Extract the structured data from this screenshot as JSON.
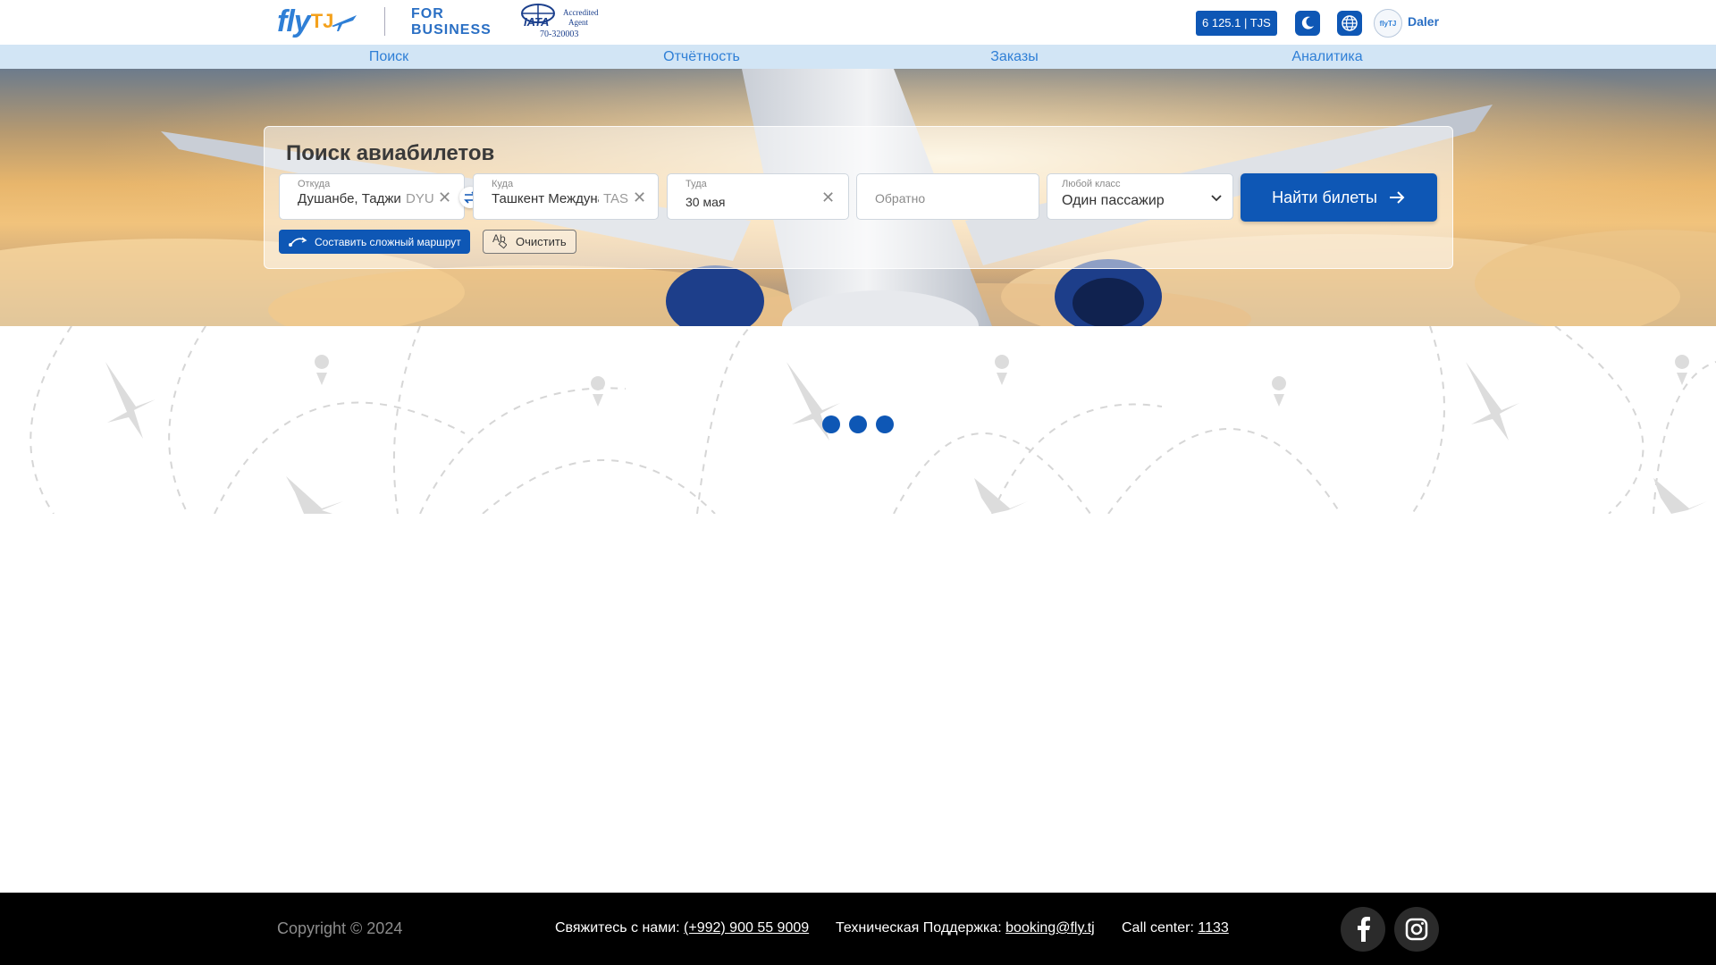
{
  "header": {
    "logo_text": "fly",
    "logo_tj": "TJ",
    "business_line1": "FOR",
    "business_line2": "BUSINESS",
    "iata_label": "IATA",
    "iata_accredited": "Accredited",
    "iata_agent": "Agent",
    "iata_code": "70-320003",
    "balance": "6 125.1 | TJS",
    "avatar_text": "flyTJ",
    "username": "Daler",
    "icons": [
      "moon-icon",
      "globe-icon"
    ]
  },
  "nav": {
    "items": [
      "Поиск",
      "Отчётность",
      "Заказы",
      "Аналитика"
    ]
  },
  "search": {
    "title": "Поиск авиабилетов",
    "from": {
      "label": "Откуда",
      "value": "Душанбе, Таджикистан",
      "code": "DYU"
    },
    "to": {
      "label": "Куда",
      "value": "Ташкент Международный",
      "code": "TAS"
    },
    "depart": {
      "label": "Туда",
      "value": "30 мая"
    },
    "return": {
      "placeholder": "Обратно"
    },
    "passengers": {
      "label": "Любой класс",
      "value": "Один пассажир"
    },
    "find_button": "Найти билеты",
    "complex_route_button": "Составить сложный маршрут",
    "clear_button": "Очистить",
    "clear_icon_text": "Ab"
  },
  "footer": {
    "copyright": "Copyright © 2024",
    "contact_label": "Свяжитесь с нами:",
    "contact_phone": "(+992) 900 55 9009",
    "support_label": "Техническая Поддержка:",
    "support_email": "booking@fly.tj",
    "callcenter_label": "Call center:",
    "callcenter_number": "1133"
  },
  "colors": {
    "primary": "#0e57b5",
    "nav_bg": "#d2e5f5",
    "link": "#2f7fd6",
    "footer_bg": "#000000"
  }
}
